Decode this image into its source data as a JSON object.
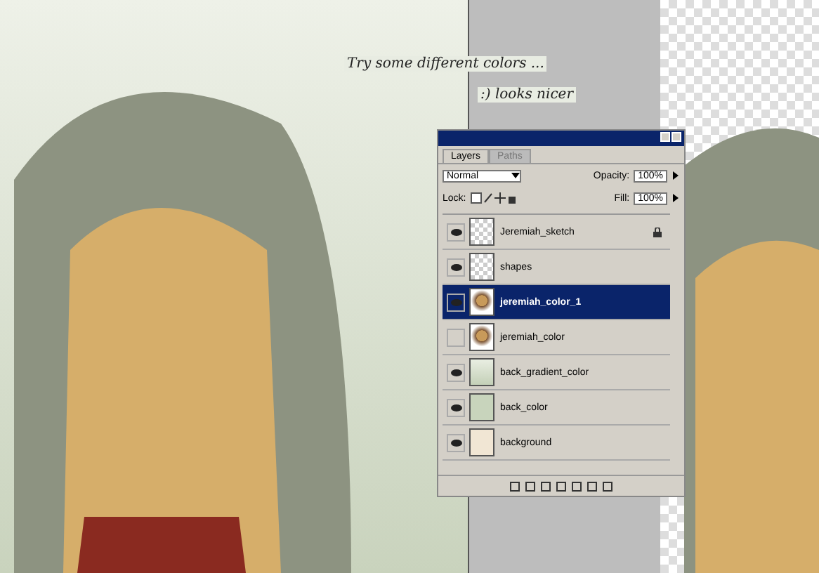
{
  "canvas_notes": [
    "Try some different colors ...",
    ":) looks nicer"
  ],
  "layers_panel": {
    "tabs": [
      {
        "label": "Layers",
        "selected": true
      },
      {
        "label": "Paths",
        "selected": false
      }
    ],
    "blend_mode": "Normal",
    "opacity_label": "Opacity:",
    "opacity": "100%",
    "lock_label": "Lock:",
    "fill_label": "Fill:",
    "fill": "100%",
    "layers": [
      {
        "name": "Jeremiah_sketch",
        "visible": true,
        "locked": true,
        "selected": false,
        "kind": "checker"
      },
      {
        "name": "shapes",
        "visible": true,
        "locked": false,
        "selected": false,
        "kind": "checker"
      },
      {
        "name": "jeremiah_color_1",
        "visible": true,
        "locked": false,
        "selected": true,
        "kind": "portrait"
      },
      {
        "name": "jeremiah_color",
        "visible": false,
        "locked": false,
        "selected": false,
        "kind": "portrait"
      },
      {
        "name": "back_gradient_color",
        "visible": true,
        "locked": false,
        "selected": false,
        "kind": "gradient"
      },
      {
        "name": "back_color",
        "visible": true,
        "locked": false,
        "selected": false,
        "kind": "green"
      },
      {
        "name": "background",
        "visible": true,
        "locked": false,
        "selected": false,
        "kind": "cream"
      }
    ]
  }
}
